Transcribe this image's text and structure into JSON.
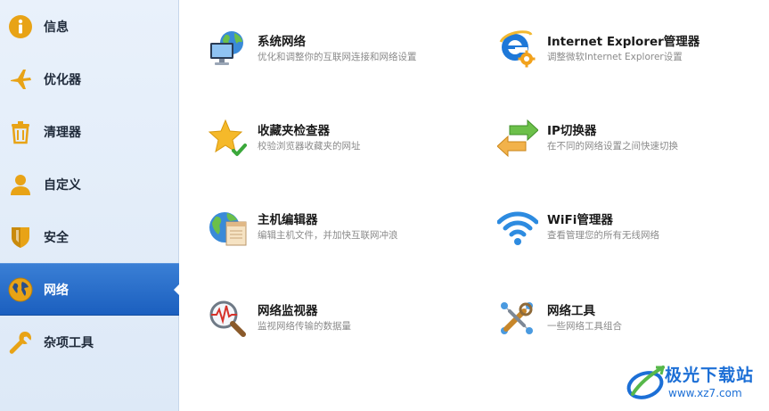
{
  "sidebar": {
    "items": [
      {
        "label": "信息",
        "icon": "info-icon"
      },
      {
        "label": "优化器",
        "icon": "airplane-icon"
      },
      {
        "label": "清理器",
        "icon": "trash-icon"
      },
      {
        "label": "自定义",
        "icon": "user-icon"
      },
      {
        "label": "安全",
        "icon": "shield-icon"
      },
      {
        "label": "网络",
        "icon": "globe-icon",
        "active": true
      },
      {
        "label": "杂项工具",
        "icon": "wrench-icon"
      }
    ]
  },
  "tools": [
    {
      "title": "系统网络",
      "desc": "优化和调整你的互联网连接和网络设置",
      "icon": "globe-monitor-icon"
    },
    {
      "title": "Internet Explorer管理器",
      "desc": "调整微软Internet Explorer设置",
      "icon": "ie-gear-icon"
    },
    {
      "title": "收藏夹检查器",
      "desc": "校验浏览器收藏夹的网址",
      "icon": "star-check-icon"
    },
    {
      "title": "IP切换器",
      "desc": "在不同的网络设置之间快速切换",
      "icon": "swap-arrows-icon"
    },
    {
      "title": "主机编辑器",
      "desc": "编辑主机文件，并加快互联网冲浪",
      "icon": "globe-document-icon"
    },
    {
      "title": "WiFi管理器",
      "desc": "查看管理您的所有无线网络",
      "icon": "wifi-icon"
    },
    {
      "title": "网络监视器",
      "desc": "监视网络传输的数据量",
      "icon": "magnifier-pulse-icon"
    },
    {
      "title": "网络工具",
      "desc": "一些网络工具组合",
      "icon": "network-tools-icon"
    }
  ],
  "watermark": {
    "title": "极光下载站",
    "url": "www.xz7.com"
  },
  "colors": {
    "sidebar_bg": "#e4eef9",
    "active_bg": "#2468c8",
    "icon_gold": "#e8a316",
    "text_dark": "#1a1a1a",
    "text_desc": "#8a8a8a",
    "watermark_blue": "#1c6fd6"
  }
}
